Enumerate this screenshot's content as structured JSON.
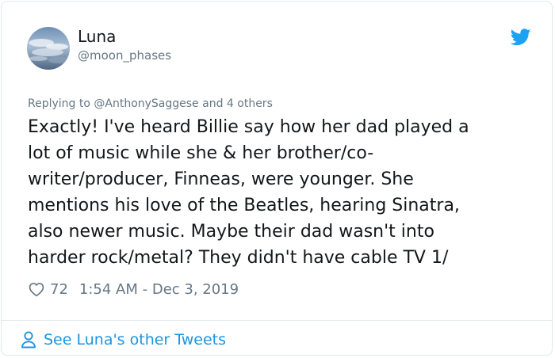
{
  "author": {
    "display_name": "Luna",
    "handle": "@moon_phases",
    "avatar_icon": "avatar-sky-photo"
  },
  "brand": {
    "icon": "twitter-bird-icon",
    "color": "#1da1f2"
  },
  "reply": {
    "label": "Replying to @AnthonySaggese and 4 others"
  },
  "tweet": {
    "text": "Exactly! I've heard Billie say how her dad played a\nlot of music while she & her brother/co-\nwriter/producer, Finneas, were younger. She\nmentions his love of the Beatles, hearing Sinatra,\nalso newer music. Maybe their dad wasn't into\nharder rock/metal? They didn't have cable TV 1/"
  },
  "meta": {
    "like_icon": "heart-icon",
    "like_count": "72",
    "timestamp": "1:54 AM - Dec 3, 2019"
  },
  "footer": {
    "icon": "person-icon",
    "link_label": "See Luna's other Tweets"
  },
  "colors": {
    "text_primary": "#14171a",
    "text_secondary": "#657786",
    "link": "#1b95e0",
    "border": "#e1e8ed"
  }
}
